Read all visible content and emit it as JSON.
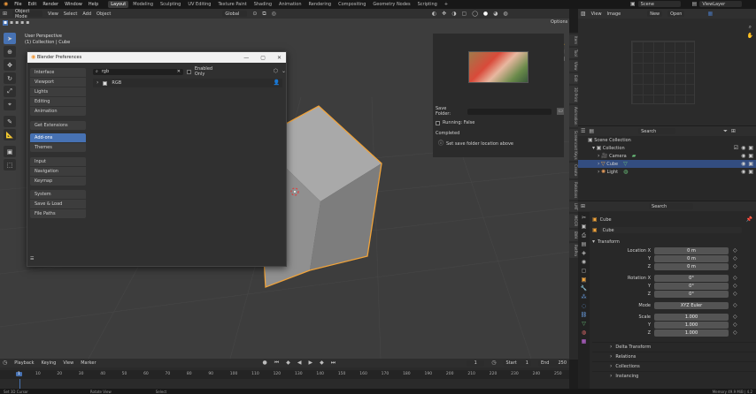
{
  "top_menu": {
    "items": [
      "File",
      "Edit",
      "Render",
      "Window",
      "Help"
    ],
    "tabs": [
      "Layout",
      "Modeling",
      "Sculpting",
      "UV Editing",
      "Texture Paint",
      "Shading",
      "Animation",
      "Rendering",
      "Compositing",
      "Geometry Nodes",
      "Scripting"
    ],
    "active_tab": "Layout",
    "add_tab": "+",
    "scene_label": "Scene",
    "viewlayer_label": "ViewLayer"
  },
  "viewport": {
    "mode": "Object Mode",
    "menus": [
      "View",
      "Select",
      "Add",
      "Object"
    ],
    "transform_orientation": "Global",
    "options_label": "Options",
    "perspective": "User Perspective",
    "collection_info": "(1) Collection | Cube"
  },
  "npanel": {
    "save_folder_label": "Save Folder:",
    "running_label": "Running: False",
    "completed_label": "Completed",
    "hint": "Set save folder location above",
    "tabs": [
      "Item",
      "Tool",
      "View",
      "Edit",
      "3D Print",
      "Animation",
      "Screencast Keys",
      "Create",
      "Relations",
      "LMT",
      "MOCR",
      "BVH",
      "RetPro"
    ]
  },
  "image_editor": {
    "menus": [
      "View",
      "Image"
    ],
    "new_label": "New",
    "open_label": "Open"
  },
  "outliner": {
    "search_placeholder": "Search",
    "items": [
      {
        "label": "Scene Collection",
        "depth": 0
      },
      {
        "label": "Collection",
        "depth": 1
      },
      {
        "label": "Camera",
        "depth": 2
      },
      {
        "label": "Cube",
        "depth": 2,
        "selected": true
      },
      {
        "label": "Light",
        "depth": 2
      }
    ]
  },
  "properties": {
    "search_placeholder": "Search",
    "object_name": "Cube",
    "object_field": "Cube",
    "transform_header": "Transform",
    "location": {
      "label": "Location",
      "x": "0 m",
      "y": "0 m",
      "z": "0 m"
    },
    "rotation": {
      "label": "Rotation",
      "x": "0°",
      "y": "0°",
      "z": "0°"
    },
    "mode": {
      "label": "Mode",
      "value": "XYZ Euler"
    },
    "scale": {
      "label": "Scale",
      "x": "1.000",
      "y": "1.000",
      "z": "1.000"
    },
    "axis_labels": [
      "X",
      "Y",
      "Z"
    ],
    "sections": [
      "Delta Transform",
      "Relations",
      "Collections",
      "Instancing"
    ]
  },
  "timeline": {
    "menus": [
      "Playback",
      "Keying",
      "View",
      "Marker"
    ],
    "current_frame": "1",
    "start_label": "Start",
    "start_value": "1",
    "end_label": "End",
    "end_value": "250",
    "ruler": [
      "1",
      "10",
      "20",
      "30",
      "40",
      "50",
      "60",
      "70",
      "80",
      "90",
      "100",
      "110",
      "120",
      "130",
      "140",
      "150",
      "160",
      "170",
      "180",
      "190",
      "200",
      "210",
      "220",
      "230",
      "240",
      "250"
    ]
  },
  "statusbar": {
    "items": [
      "Set 3D Cursor",
      "Rotate View",
      "Select"
    ],
    "memory": "Memory 49.9 MiB | 4.2"
  },
  "preferences": {
    "title": "Blender Preferences",
    "search_value": "rgb",
    "enabled_only_label": "Enabled Only",
    "addon_name": "RGB",
    "nav_groups": [
      [
        "Interface",
        "Viewport",
        "Lights",
        "Editing",
        "Animation"
      ],
      [
        "Get Extensions"
      ],
      [
        "Add-ons",
        "Themes"
      ],
      [
        "Input",
        "Navigation",
        "Keymap"
      ],
      [
        "System",
        "Save & Load",
        "File Paths"
      ]
    ],
    "active_nav": "Add-ons"
  },
  "colors": {
    "accent": "#4772b3",
    "selection_orange": "#f0a33a",
    "background": "#3d3d3d"
  }
}
